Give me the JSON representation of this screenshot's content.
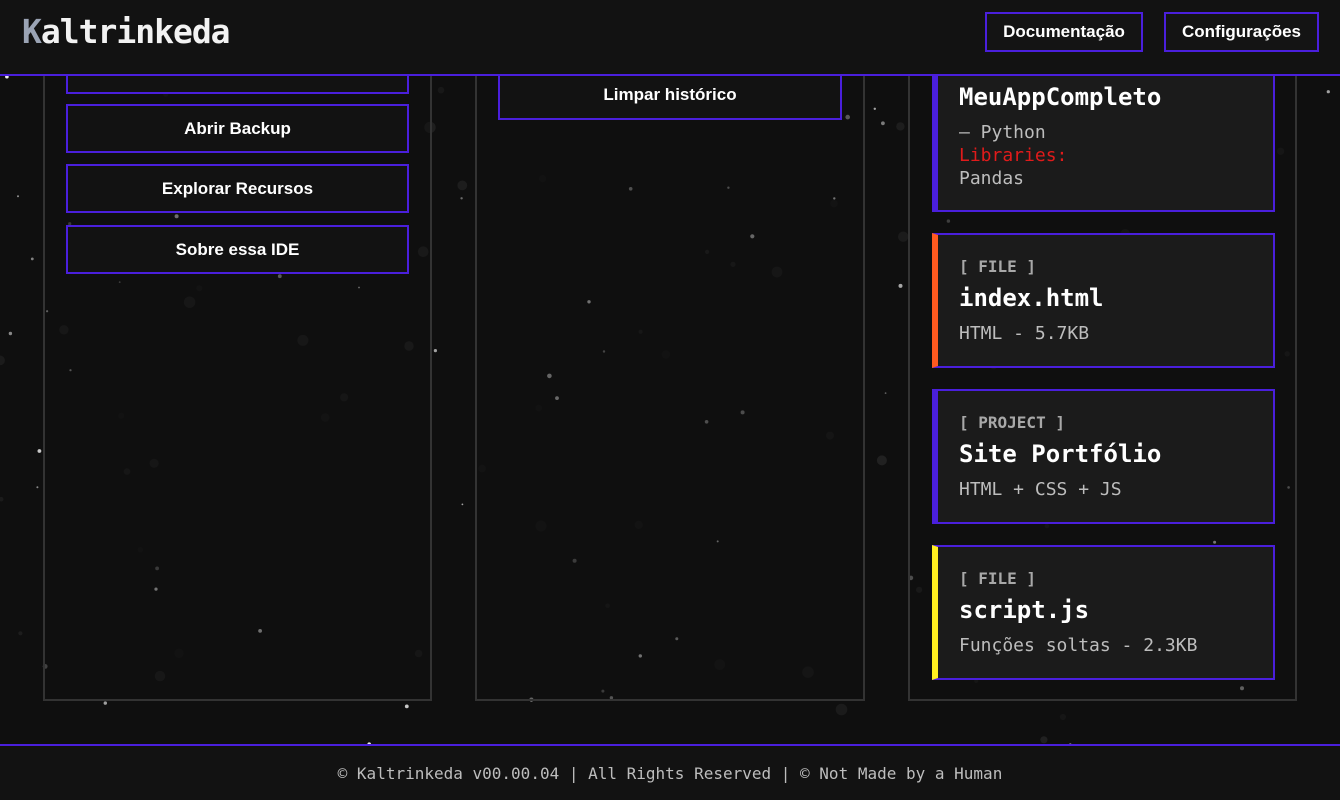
{
  "header": {
    "logo_first": "K",
    "logo_rest": "altrinkeda",
    "buttons": [
      "Documentação",
      "Configurações"
    ]
  },
  "left_panel": {
    "buttons": [
      "Abrir Backup",
      "Explorar Recursos",
      "Sobre essa IDE"
    ]
  },
  "middle_panel": {
    "clear_button": "Limpar histórico"
  },
  "right_panel": {
    "cards": [
      {
        "title": "MeuAppCompleto",
        "desc": "— Python",
        "libraries_label": "Libraries:",
        "libraries": "Pandas",
        "accent": "#4a1fdc"
      },
      {
        "tag": "[ FILE ]",
        "title": "index.html",
        "desc": "HTML - 5.7KB",
        "accent": "#ff5a1f"
      },
      {
        "tag": "[ PROJECT ]",
        "title": "Site Portfólio",
        "desc": "HTML + CSS + JS",
        "accent": "#4a1fdc"
      },
      {
        "tag": "[ FILE ]",
        "title": "script.js",
        "desc": "Funções soltas - 2.3KB",
        "accent": "#ffee20"
      }
    ]
  },
  "footer": {
    "text": "© Kaltrinkeda v00.00.04 | All Rights Reserved | © Not Made by a Human"
  },
  "colors": {
    "accent": "#4a1fdc",
    "libraries_label": "#e01b1b",
    "background": "#0f0f0f"
  }
}
